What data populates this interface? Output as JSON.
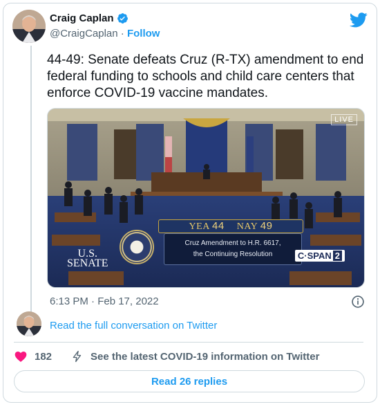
{
  "author": {
    "display_name": "Craig Caplan",
    "handle": "@CraigCaplan",
    "separator": "·",
    "follow_label": "Follow",
    "verified": true
  },
  "tweet": {
    "text": "44-49: Senate defeats Cruz (R-TX) amendment to end federal funding to schools and child care centers that enforce COVID-19 vaccine mandates.",
    "timestamp": "6:13 PM · Feb 17, 2022"
  },
  "media": {
    "live_label": "LIVE",
    "yea_label": "YEA",
    "yea_count": "44",
    "nay_label": "NAY",
    "nay_count": "49",
    "caption_line1": "Cruz Amendment to H.R. 6617,",
    "caption_line2": "the Continuing Resolution",
    "brand_line1": "U.S.",
    "brand_line2": "SENATE",
    "network": "C·SPAN",
    "network_channel": "2"
  },
  "conversation_link": "Read the full conversation on Twitter",
  "actions": {
    "like_count": "182",
    "covid_link": "See the latest COVID-19 information on Twitter"
  },
  "replies_button": "Read 26 replies",
  "colors": {
    "accent": "#1d9bf0",
    "like": "#f91880",
    "text_secondary": "#536471"
  }
}
